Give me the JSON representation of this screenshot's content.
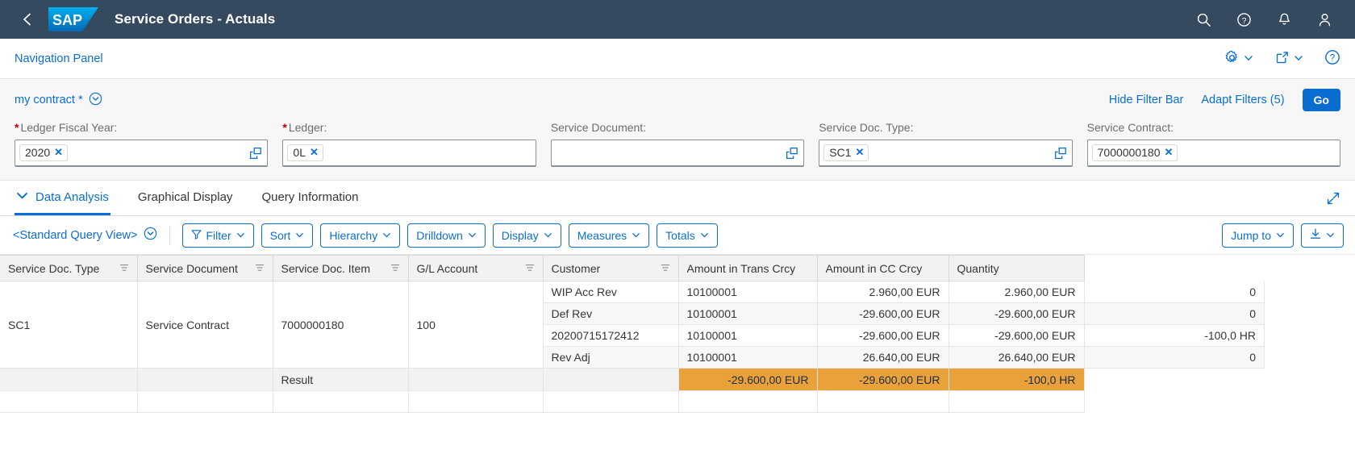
{
  "shell": {
    "title": "Service Orders - Actuals",
    "logo_text": "SAP",
    "back_icon": "back-chevron-icon",
    "icons": [
      {
        "name": "search-icon",
        "label": "Search"
      },
      {
        "name": "help-icon",
        "label": "Help"
      },
      {
        "name": "notifications-bell-icon",
        "label": "Notifications"
      },
      {
        "name": "user-avatar-icon",
        "label": "User"
      }
    ],
    "bg_color": "#354A5F"
  },
  "subheader": {
    "nav_panel": "Navigation Panel",
    "actions": [
      {
        "name": "settings-gear-icon",
        "label": ""
      },
      {
        "name": "share-icon",
        "label": ""
      },
      {
        "name": "help-circle-icon",
        "label": ""
      }
    ]
  },
  "filterbar": {
    "variant": "my contract *",
    "hide_filter_bar": "Hide Filter Bar",
    "adapt_filters": "Adapt Filters (5)",
    "go": "Go",
    "accent_color": "#0a6ed1",
    "fields": [
      {
        "label": "Ledger Fiscal Year:",
        "required": true,
        "token": "2020",
        "has_value_help": true
      },
      {
        "label": "Ledger:",
        "required": true,
        "token": "0L",
        "has_value_help": false
      },
      {
        "label": "Service Document:",
        "required": false,
        "token": "",
        "has_value_help": true
      },
      {
        "label": "Service Doc. Type:",
        "required": false,
        "token": "SC1",
        "has_value_help": true
      },
      {
        "label": "Service Contract:",
        "required": false,
        "token": "7000000180",
        "has_value_help": false
      }
    ]
  },
  "tabs": [
    {
      "label": "Data Analysis",
      "selected": true
    },
    {
      "label": "Graphical Display",
      "selected": false
    },
    {
      "label": "Query Information",
      "selected": false
    }
  ],
  "toolbar": {
    "query_view": "<Standard Query View>",
    "buttons": [
      {
        "label": "Filter",
        "icon": "filter-icon"
      },
      {
        "label": "Sort",
        "icon": ""
      },
      {
        "label": "Hierarchy",
        "icon": ""
      },
      {
        "label": "Drilldown",
        "icon": ""
      },
      {
        "label": "Display",
        "icon": ""
      },
      {
        "label": "Measures",
        "icon": ""
      },
      {
        "label": "Totals",
        "icon": ""
      }
    ],
    "jump_to": "Jump to",
    "download_icon": "download-icon"
  },
  "table": {
    "columns": [
      {
        "label": "Service Doc. Type",
        "align": "left",
        "sortable": true,
        "focused": false
      },
      {
        "label": "Service Document",
        "align": "left",
        "sortable": true,
        "focused": false
      },
      {
        "label": "Service Doc. Item",
        "align": "left",
        "sortable": true,
        "focused": false
      },
      {
        "label": "G/L Account",
        "align": "left",
        "sortable": true,
        "focused": false
      },
      {
        "label": "Customer",
        "align": "left",
        "sortable": true,
        "focused": true
      },
      {
        "label": "Amount in Trans Crcy",
        "align": "right",
        "sortable": false,
        "focused": false
      },
      {
        "label": "Amount in CC Crcy",
        "align": "right",
        "sortable": false,
        "focused": false
      },
      {
        "label": "Quantity",
        "align": "right",
        "sortable": false,
        "focused": false
      }
    ],
    "merged": {
      "service_doc_type": "SC1",
      "service_document_label": "Service Contract",
      "service_document_number": "7000000180",
      "service_doc_item": "100"
    },
    "rows": [
      {
        "gl_account": "WIP Acc Rev",
        "customer": "10100001",
        "amount_trans": "2.960,00 EUR",
        "amount_cc": "2.960,00 EUR",
        "quantity": "0"
      },
      {
        "gl_account": "Def Rev",
        "customer": "10100001",
        "amount_trans": "-29.600,00 EUR",
        "amount_cc": "-29.600,00 EUR",
        "quantity": "0"
      },
      {
        "gl_account": "20200715172412",
        "customer": "10100001",
        "amount_trans": "-29.600,00 EUR",
        "amount_cc": "-29.600,00 EUR",
        "quantity": "-100,0 HR"
      },
      {
        "gl_account": "Rev Adj",
        "customer": "10100001",
        "amount_trans": "26.640,00 EUR",
        "amount_cc": "26.640,00 EUR",
        "quantity": "0"
      }
    ],
    "result": {
      "label": "Result",
      "amount_trans": "-29.600,00 EUR",
      "amount_cc": "-29.600,00 EUR",
      "quantity": "-100,0 HR",
      "highlight_color": "#E9A13B"
    }
  }
}
